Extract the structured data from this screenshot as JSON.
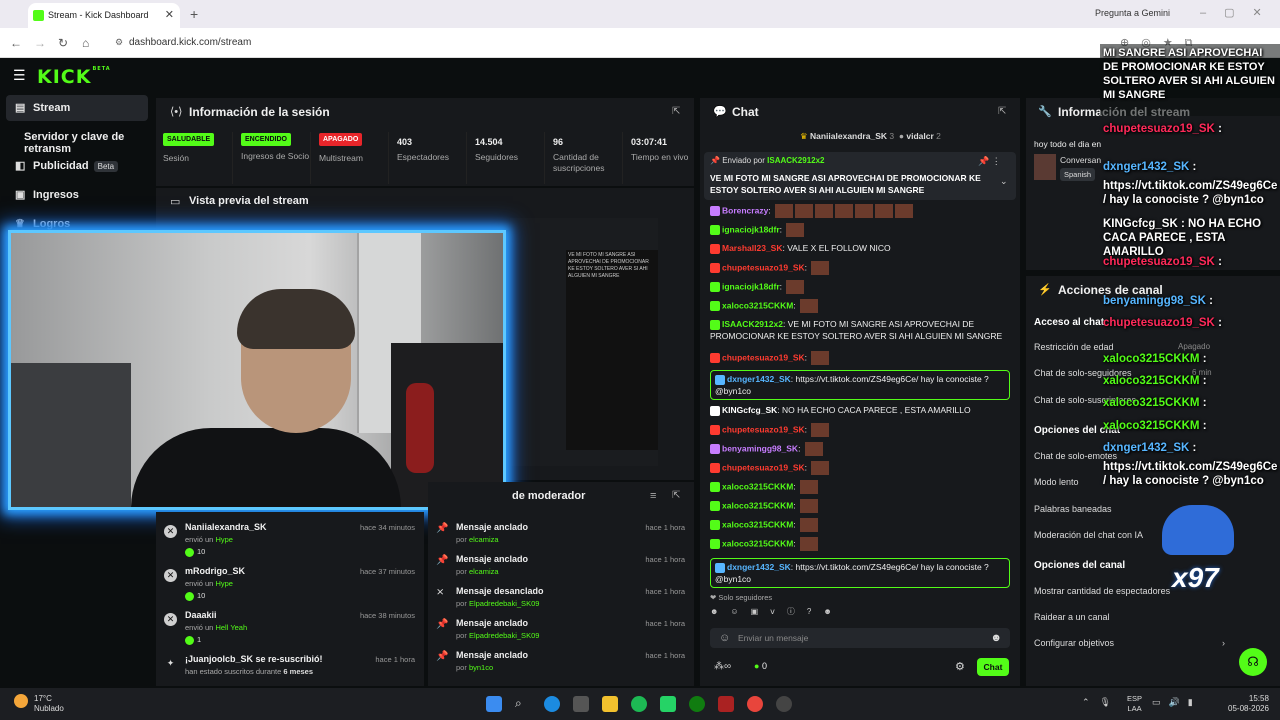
{
  "browser": {
    "tab_title": "Stream - Kick Dashboard",
    "url": "dashboard.kick.com/stream",
    "gemini_label": "Pregunta a Gemini"
  },
  "kick": {
    "logo": "KICK",
    "logo_sup": "BETA"
  },
  "sidebar": {
    "items": [
      {
        "label": "Stream",
        "icon": "stream-icon"
      },
      {
        "label": "Servidor y clave de retransm",
        "icon": "key-icon"
      },
      {
        "label": "Publicidad",
        "icon": "ad-icon",
        "badge": "Beta"
      },
      {
        "label": "Ingresos",
        "icon": "money-icon"
      },
      {
        "label": "Logros",
        "icon": "trophy-icon"
      }
    ]
  },
  "session": {
    "title": "Información de la sesión",
    "stats": [
      {
        "value": "SALUDABLE",
        "label": "Sesión",
        "color": "#53fc18",
        "text": "#0b0e0f"
      },
      {
        "value": "ENCENDIDO",
        "label": "Ingresos de Socio",
        "color": "#53fc18",
        "text": "#0b0e0f"
      },
      {
        "value": "APAGADO",
        "label": "Multistream",
        "color": "#e8252a",
        "text": "#ffffff"
      },
      {
        "value": "403",
        "label": "Espectadores"
      },
      {
        "value": "14.504",
        "label": "Seguidores"
      },
      {
        "value": "96",
        "label": "Cantidad de suscripciones"
      },
      {
        "value": "03:07:41",
        "label": "Tiempo en vivo"
      }
    ]
  },
  "preview": {
    "title": "Vista previa del stream"
  },
  "activity": [
    {
      "name": "Naniialexandra_SK",
      "action": "envió un",
      "item": "Hype",
      "amount": "10",
      "time": "hace 34 minutos"
    },
    {
      "name": "mRodrigo_SK",
      "action": "envió un",
      "item": "Hype",
      "amount": "10",
      "time": "hace 37 minutos"
    },
    {
      "name": "Daaakii",
      "action": "envió un",
      "item": "Hell Yeah",
      "amount": "1",
      "time": "hace 38 minutos"
    },
    {
      "name": "¡Juanjoolcb_SK se re-suscribió!",
      "action": "han estado suscritos durante",
      "item": "6 meses",
      "amount": "",
      "time": "hace 1 hora"
    }
  ],
  "moderator": {
    "title": "de moderador",
    "items": [
      {
        "label": "Mensaje anclado",
        "by": "por",
        "user": "elcamiza",
        "time": "hace 1 hora"
      },
      {
        "label": "Mensaje anclado",
        "by": "por",
        "user": "elcamiza",
        "time": "hace 1 hora"
      },
      {
        "label": "Mensaje desanclado",
        "by": "por",
        "user": "Elpadredebaki_SK09",
        "time": "hace 1 hora"
      },
      {
        "label": "Mensaje anclado",
        "by": "por",
        "user": "Elpadredebaki_SK09",
        "time": "hace 1 hora"
      },
      {
        "label": "Mensaje anclado",
        "by": "por",
        "user": "byn1co",
        "time": "hace 1 hora"
      }
    ]
  },
  "chat": {
    "title": "Chat",
    "top_gifters": [
      {
        "name": "Naniialexandra_SK",
        "count": "3"
      },
      {
        "name": "vidalcr",
        "count": "2"
      }
    ],
    "pinned_by": "Enviado por",
    "pinned_user": "ISAACK2912x2",
    "pinned_text": "VE MI FOTO MI SANGRE ASI APROVECHAI DE PROMOCIONAR KE ESTOY SOLTERO AVER SI AHI ALGUIEN MI SANGRE",
    "messages": [
      {
        "user": "Borencrazy",
        "color": "#c77dff",
        "text": "",
        "emotes": 7
      },
      {
        "user": "ignaciojk18dfr",
        "color": "#53fc18",
        "text": "",
        "emotes": 1
      },
      {
        "user": "Marshall23_SK",
        "color": "#ff3b30",
        "text": "VALE X EL FOLLOW NICO",
        "emotes": 0
      },
      {
        "user": "chupetesuazo19_SK",
        "color": "#ff3b30",
        "text": "",
        "emotes": 1
      },
      {
        "user": "ignaciojk18dfr",
        "color": "#53fc18",
        "text": "",
        "emotes": 1
      },
      {
        "user": "xaloco3215CKKM",
        "color": "#53fc18",
        "text": "",
        "emotes": 1
      },
      {
        "user": "ISAACK2912x2",
        "color": "#53fc18",
        "text": "VE MI FOTO MI SANGRE ASI APROVECHAI DE PROMOCIONAR KE ESTOY SOLTERO AVER SI AHI ALGUIEN MI SANGRE",
        "emotes": 0
      },
      {
        "user": "chupetesuazo19_SK",
        "color": "#ff3b30",
        "text": "",
        "emotes": 1
      },
      {
        "user": "dxnger1432_SK",
        "color": "#57b6ff",
        "text": "https://vt.tiktok.com/ZS49eg6Ce/ hay la conociste ? @byn1co",
        "emotes": 0,
        "highlight": true
      },
      {
        "user": "KINGcfcg_SK",
        "color": "#ffffff",
        "text": "NO HA ECHO CACA PARECE , ESTA AMARILLO",
        "emotes": 0
      },
      {
        "user": "chupetesuazo19_SK",
        "color": "#ff3b30",
        "text": "",
        "emotes": 1
      },
      {
        "user": "benyamingg98_SK",
        "color": "#c77dff",
        "text": "",
        "emotes": 1
      },
      {
        "user": "chupetesuazo19_SK",
        "color": "#ff3b30",
        "text": "",
        "emotes": 1
      },
      {
        "user": "xaloco3215CKKM",
        "color": "#53fc18",
        "text": "",
        "emotes": 1
      },
      {
        "user": "xaloco3215CKKM",
        "color": "#53fc18",
        "text": "",
        "emotes": 1
      },
      {
        "user": "xaloco3215CKKM",
        "color": "#53fc18",
        "text": "",
        "emotes": 1
      },
      {
        "user": "xaloco3215CKKM",
        "color": "#53fc18",
        "text": "",
        "emotes": 1
      },
      {
        "user": "dxnger1432_SK",
        "color": "#57b6ff",
        "text": "https://vt.tiktok.com/ZS49eg6Ce/ hay la conociste ? @byn1co",
        "emotes": 0,
        "highlight": true
      }
    ],
    "followers_only": "Solo seguidores",
    "input_placeholder": "Enviar un mensaje",
    "points": "0",
    "send_label": "Chat"
  },
  "info": {
    "title": "Información del stream",
    "stream_title": "hoy todo el dia en",
    "category": "Conversan",
    "language": "Spanish"
  },
  "channel_actions": {
    "title": "Acciones de canal",
    "chat_access": "Acceso al chat",
    "items1": [
      {
        "label": "Restricción de edad",
        "value": "Apagado"
      },
      {
        "label": "Chat de solo-seguidores",
        "value": "6 min"
      },
      {
        "label": "Chat de solo-suscriptores",
        "value": ""
      }
    ],
    "chat_options": "Opciones del chat",
    "items2": [
      {
        "label": "Chat de solo-emotes"
      },
      {
        "label": "Modo lento"
      },
      {
        "label": "Palabras baneadas"
      },
      {
        "label": "Moderación del chat con IA"
      }
    ],
    "channel_options": "Opciones del canal",
    "items3": [
      {
        "label": "Mostrar cantidad de espectadores"
      },
      {
        "label": "Raidear a un canal"
      },
      {
        "label": "Configurar objetivos"
      }
    ]
  },
  "overlay": {
    "pinned": "MI SANGRE ASI APROVECHAI DE PROMOCIONAR KE ESTOY SOLTERO AVER SI AHI ALGUIEN MI SANGRE",
    "lines": [
      {
        "user": "chupetesuazo19_SK",
        "text": ":",
        "cls": "ovr"
      },
      {
        "user": "dxnger1432_SK",
        "text": ":",
        "cls": "ovb"
      },
      {
        "user": "",
        "text": "https://vt.tiktok.com/ZS49eg6Ce / hay la conociste ? @byn1co",
        "cls": "ovw"
      },
      {
        "user": "KINGcfcg_SK",
        "text": ": NO HA ECHO CACA PARECE , ESTA AMARILLO",
        "cls": "ovw"
      },
      {
        "user": "chupetesuazo19_SK",
        "text": ":",
        "cls": "ovr"
      },
      {
        "user": "benyamingg98_SK",
        "text": ":",
        "cls": "ovb"
      },
      {
        "user": "chupetesuazo19_SK",
        "text": ":",
        "cls": "ovr"
      },
      {
        "user": "xaloco3215CKKM",
        "text": ":",
        "cls": "ovg"
      },
      {
        "user": "xaloco3215CKKM",
        "text": ":",
        "cls": "ovg"
      },
      {
        "user": "xaloco3215CKKM",
        "text": ":",
        "cls": "ovg"
      },
      {
        "user": "xaloco3215CKKM",
        "text": ":",
        "cls": "ovg"
      },
      {
        "user": "dxnger1432_SK",
        "text": ":",
        "cls": "ovb"
      },
      {
        "user": "",
        "text": "https://vt.tiktok.com/ZS49eg6Ce / hay la conociste ? @byn1co",
        "cls": "ovw"
      }
    ],
    "counter": "x97"
  },
  "taskbar": {
    "temp": "17°C",
    "weather": "Nublado",
    "lang1": "ESP",
    "lang2": "LAA",
    "time": "15:58",
    "date": "05-08-2026"
  }
}
